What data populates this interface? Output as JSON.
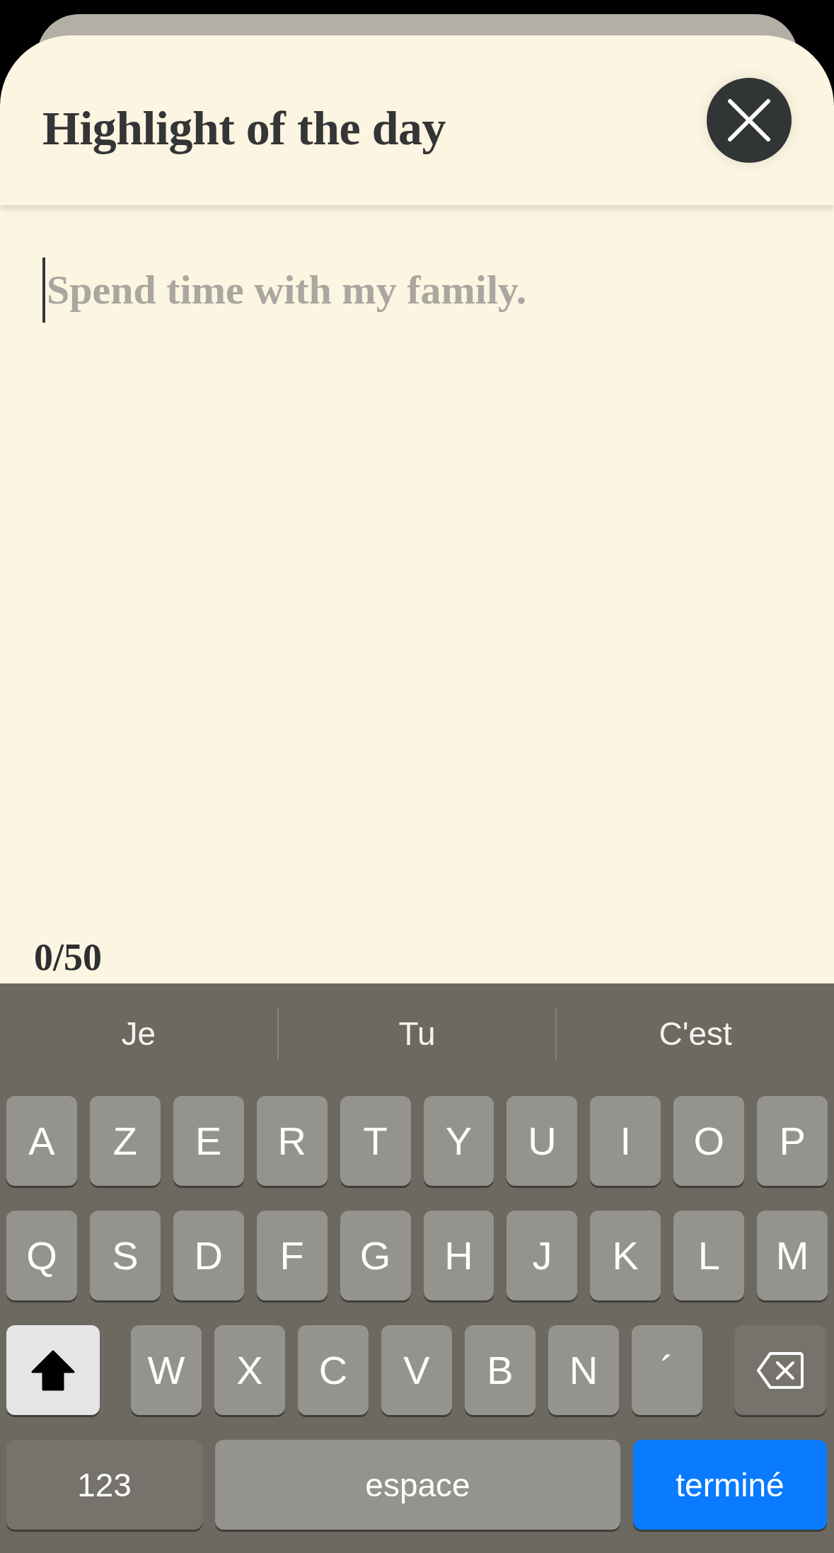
{
  "sheet": {
    "title": "Highlight of the day"
  },
  "field": {
    "placeholder": "Spend time with my family.",
    "focused": true
  },
  "counter": "0/50",
  "keyboard": {
    "suggestions": [
      "Je",
      "Tu",
      "C'est"
    ],
    "letter_rows": [
      [
        "A",
        "Z",
        "E",
        "R",
        "T",
        "Y",
        "U",
        "I",
        "O",
        "P"
      ],
      [
        "Q",
        "S",
        "D",
        "F",
        "G",
        "H",
        "J",
        "K",
        "L",
        "M"
      ]
    ],
    "third_row": {
      "shift_on": true,
      "letters": [
        "W",
        "X",
        "C",
        "V",
        "B",
        "N",
        "´"
      ]
    },
    "bottom_keys": {
      "numbers_key": "123",
      "space_key": "espace",
      "done_key": "terminé"
    }
  }
}
